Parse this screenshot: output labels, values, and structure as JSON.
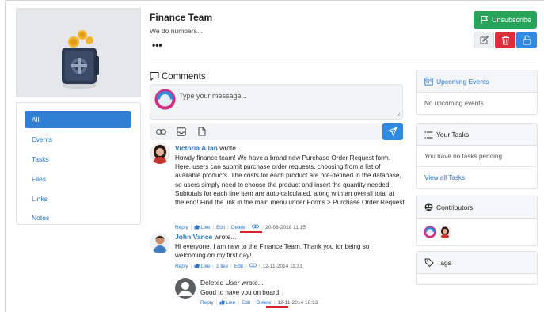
{
  "group": {
    "title": "Finance Team",
    "subtitle": "We do numbers...",
    "more": "•••",
    "unsubscribe_label": "Unsubscribe"
  },
  "nav": {
    "items": [
      {
        "label": "All",
        "active": true
      },
      {
        "label": "Events"
      },
      {
        "label": "Tasks"
      },
      {
        "label": "Files"
      },
      {
        "label": "Links"
      },
      {
        "label": "Notes"
      }
    ]
  },
  "comments": {
    "title": "Comments",
    "placeholder": "Type your message...",
    "items": [
      {
        "author": "Victoria Allan",
        "wrote": " wrote...",
        "body": "Howdy finance team! We have a brand new Purchase Order Request form. Here, users can submit purchase order requests, choosing from a list of available products. The costs for each product are pre-defined in the database, so users simply need to choose the product and insert the quantity needed. Subtotals for each line item are auto-calculated, along with an overall total at the end! Find the link in the main menu under Forms > Purchase Order Request",
        "reply": "Reply",
        "like": "Like",
        "edit": "Edit",
        "delete": "Delete",
        "timestamp": "20-08-2018 11:15"
      },
      {
        "author": "John Vance",
        "wrote": " wrote...",
        "body": "Hi everyone. I am new to the Finance Team. Thank you for being so welcoming on my first day!",
        "reply": "Reply",
        "like": "Like",
        "likes_count": "1 like",
        "edit": "Edit",
        "timestamp": "12-11-2014 11:31"
      },
      {
        "author": "Deleted User",
        "wrote": " wrote...",
        "body": "Good to have you on board!",
        "reply": "Reply",
        "like": "Like",
        "edit": "Edit",
        "delete": "Delete",
        "timestamp": "12-11-2014 16:13"
      }
    ]
  },
  "sidebar_right": {
    "upcoming_events": {
      "title": "Upcoming Events",
      "empty": "No upcoming events"
    },
    "your_tasks": {
      "title": "Your Tasks",
      "empty": "You have no tasks pending",
      "view_all": "View all Tasks"
    },
    "contributors": {
      "title": "Contributors"
    },
    "tags": {
      "title": "Tags"
    }
  },
  "colors": {
    "primary": "#2f7fd3",
    "success": "#27a35a",
    "danger": "#dc2f3a",
    "highlight_underline": "#d9222a"
  }
}
